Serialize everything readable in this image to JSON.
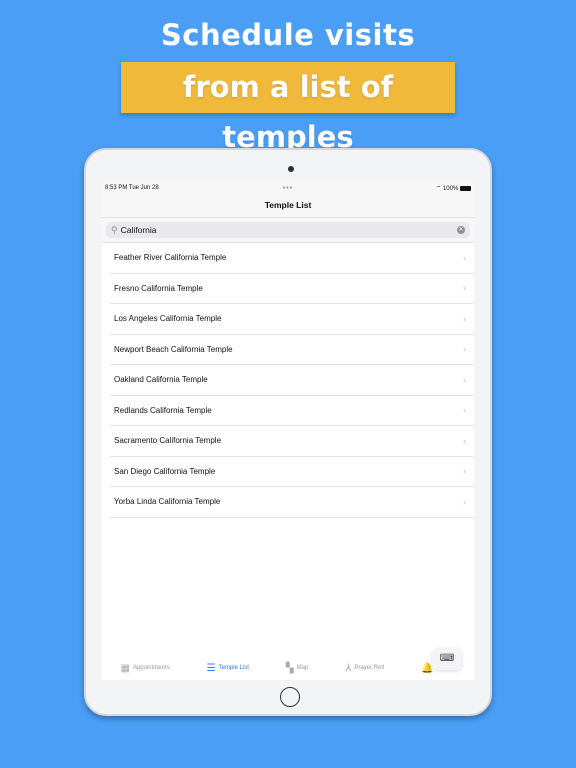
{
  "promo": {
    "headline": "Schedule visits",
    "banner": "from a list of temples",
    "colors": {
      "background": "#4a9ef5",
      "banner": "#f0b93a",
      "accent": "#3478f6"
    }
  },
  "status": {
    "time": "8:53 PM  Tue Jun 28",
    "battery": "100%"
  },
  "nav": {
    "title": "Temple List"
  },
  "search": {
    "value": "California",
    "icon": "magnifier-icon"
  },
  "temples": [
    "Feather River California Temple",
    "Fresno California Temple",
    "Los Angeles California Temple",
    "Newport Beach California Temple",
    "Oakland California Temple",
    "Redlands California Temple",
    "Sacramento California Temple",
    "San Diego California Temple",
    "Yorba Linda California Temple"
  ],
  "tabs": [
    {
      "label": "Appointments",
      "icon": "calendar-icon",
      "active": false
    },
    {
      "label": "Temple List",
      "icon": "list-icon",
      "active": true
    },
    {
      "label": "Map",
      "icon": "map-icon",
      "active": false
    },
    {
      "label": "Prayer Roll",
      "icon": "praying-hands-icon",
      "active": false
    },
    {
      "label": "Recom",
      "icon": "bell-icon",
      "active": false
    }
  ]
}
